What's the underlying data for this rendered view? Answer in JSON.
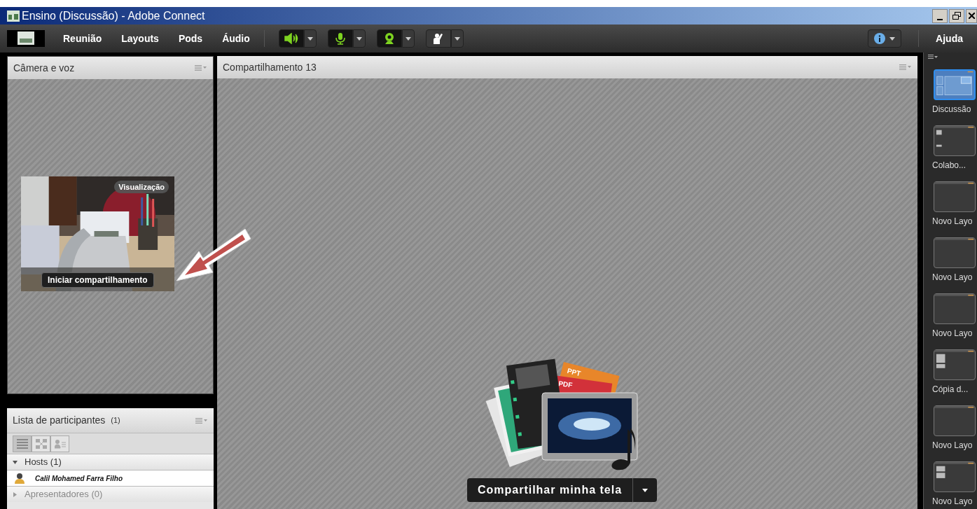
{
  "window": {
    "title": "Ensino (Discussão) - Adobe Connect"
  },
  "menu": [
    "Reunião",
    "Layouts",
    "Pods",
    "Áudio"
  ],
  "toolbar_buttons": [
    {
      "kind": "speaker",
      "active": true
    },
    {
      "kind": "microphone",
      "active": true
    },
    {
      "kind": "webcam",
      "active": true
    },
    {
      "kind": "hand",
      "active": false
    }
  ],
  "help": "Ajuda",
  "camera_pod": {
    "title": "Câmera e voz",
    "preview_badge": "Visualização",
    "start_button": "Iniciar compartilhamento"
  },
  "share_pod": {
    "title": "Compartilhamento 13",
    "graphic_labels": [
      "PPT",
      "PDF"
    ],
    "share_button": "Compartilhar minha tela"
  },
  "participants_pod": {
    "title": "Lista de participantes",
    "count": "(1)",
    "view_buttons": [
      {
        "kind": "list",
        "selected": true
      },
      {
        "kind": "grid",
        "selected": false
      },
      {
        "kind": "card",
        "selected": false
      }
    ],
    "groups": [
      {
        "label": "Hosts (1)",
        "expanded": true,
        "members": [
          "Calil Mohamed Farra Filho"
        ]
      },
      {
        "label": "Apresentadores (0)",
        "expanded": false
      }
    ]
  },
  "layouts": [
    {
      "name": "Discussão",
      "kind": "discussion",
      "selected": true
    },
    {
      "name": "Colabo...",
      "kind": "small-pair",
      "selected": false
    },
    {
      "name": "Novo Layo",
      "kind": "blank",
      "selected": false
    },
    {
      "name": "Novo Layo",
      "kind": "blank",
      "selected": false
    },
    {
      "name": "Novo Layo",
      "kind": "blank",
      "selected": false
    },
    {
      "name": "Cópia d...",
      "kind": "big-pair",
      "selected": false
    },
    {
      "name": "Novo Layo",
      "kind": "blank",
      "selected": false
    },
    {
      "name": "Novo Layo",
      "kind": "stacked",
      "selected": false
    }
  ]
}
